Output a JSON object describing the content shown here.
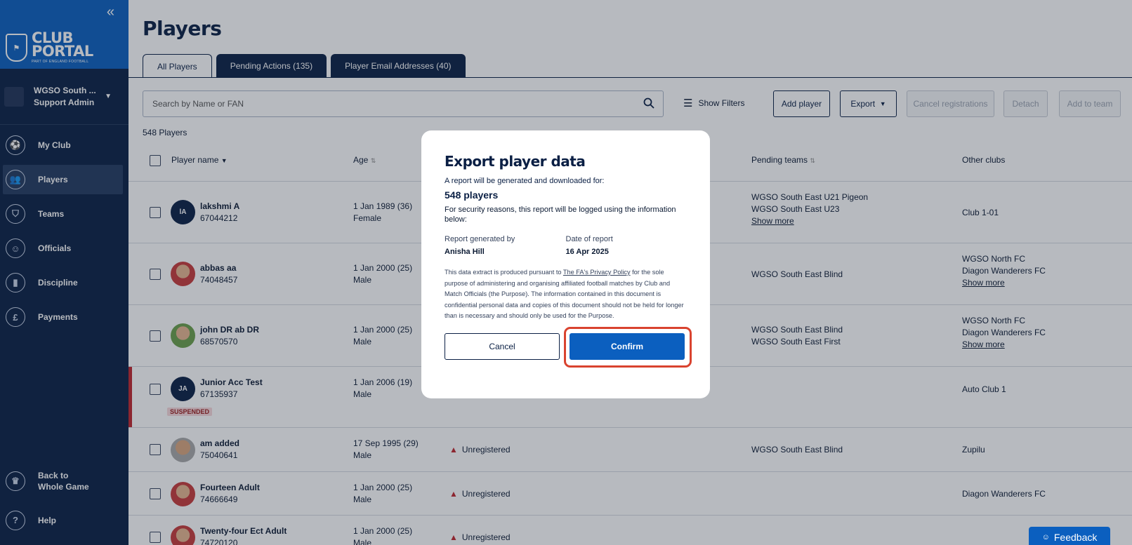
{
  "app": {
    "title": "CLUB PORTAL",
    "subtitle": "PART OF ENGLAND FOOTBALL"
  },
  "sidebar": {
    "club_name": "WGSO South ...",
    "role": "Support Admin",
    "items": [
      {
        "label": "My Club",
        "icon": "club-crest-icon"
      },
      {
        "label": "Players",
        "icon": "players-icon"
      },
      {
        "label": "Teams",
        "icon": "shield-icon"
      },
      {
        "label": "Officials",
        "icon": "officials-icon"
      },
      {
        "label": "Discipline",
        "icon": "cards-icon"
      },
      {
        "label": "Payments",
        "icon": "pound-icon"
      }
    ],
    "bottom": [
      {
        "label": "Back to Whole Game"
      },
      {
        "label": "Help"
      }
    ]
  },
  "page": {
    "title": "Players",
    "tabs": [
      "All Players",
      "Pending Actions (135)",
      "Player Email Addresses (40)"
    ],
    "search_placeholder": "Search by Name or FAN",
    "show_filters": "Show Filters",
    "buttons": {
      "add_player": "Add player",
      "export": "Export",
      "cancel_reg": "Cancel registrations",
      "detach": "Detach",
      "add_to_team": "Add to team"
    },
    "player_count": "548 Players",
    "columns": {
      "name": "Player name",
      "age": "Age",
      "pending_teams": "Pending teams",
      "other_clubs": "Other clubs"
    }
  },
  "rows": [
    {
      "initials": "lA",
      "name": "lakshmi A",
      "fan": "67044212",
      "age": "1 Jan 1989 (36)",
      "gender": "Female",
      "status": "",
      "pending1": "WGSO South East U21 Pigeon",
      "pending2": "WGSO South East U23",
      "pending_more": "Show more",
      "club1": "Club 1-01",
      "club2": "",
      "club_more": ""
    },
    {
      "initials": "",
      "name": "abbas aa",
      "fan": "74048457",
      "age": "1 Jan 2000 (25)",
      "gender": "Male",
      "status": "",
      "pending1": "WGSO South East Blind",
      "pending2": "",
      "pending_more": "",
      "club1": "WGSO North FC",
      "club2": "Diagon Wanderers FC",
      "club_more": "Show more"
    },
    {
      "initials": "",
      "name": "john DR ab DR",
      "fan": "68570570",
      "age": "1 Jan 2000 (25)",
      "gender": "Male",
      "status": "",
      "pending1": "WGSO South East Blind",
      "pending2": "WGSO South East First",
      "pending_more": "",
      "club1": "WGSO North FC",
      "club2": "Diagon Wanderers FC",
      "club_more": "Show more"
    },
    {
      "initials": "JA",
      "name": "Junior Acc Test",
      "fan": "67135937",
      "age": "1 Jan 2006 (19)",
      "gender": "Male",
      "status": "",
      "badge": "SUSPENDED",
      "pending1": "",
      "pending2": "",
      "pending_more": "",
      "club1": "Auto Club 1",
      "club2": "",
      "club_more": ""
    },
    {
      "initials": "",
      "name": "am added",
      "fan": "75040641",
      "age": "17 Sep 1995 (29)",
      "gender": "Male",
      "status": "Unregistered",
      "pending1": "WGSO South East Blind",
      "pending2": "",
      "pending_more": "",
      "club1": "Zupilu",
      "club2": "",
      "club_more": ""
    },
    {
      "initials": "",
      "name": "Fourteen Adult",
      "fan": "74666649",
      "age": "1 Jan 2000 (25)",
      "gender": "Male",
      "status": "Unregistered",
      "pending1": "",
      "pending2": "",
      "pending_more": "",
      "club1": "Diagon Wanderers FC",
      "club2": "",
      "club_more": ""
    },
    {
      "initials": "",
      "name": "Twenty-four Ect Adult",
      "fan": "74720120",
      "age": "1 Jan 2000 (25)",
      "gender": "Male",
      "status": "Unregistered",
      "pending1": "",
      "pending2": "",
      "pending_more": "",
      "club1": "",
      "club2": "",
      "club_more": ""
    }
  ],
  "modal": {
    "title": "Export player data",
    "intro": "A report will be generated and downloaded for:",
    "count": "548 players",
    "security": "For security reasons, this report will be logged using the information below:",
    "generated_by_label": "Report generated by",
    "generated_by": "Anisha Hill",
    "date_label": "Date of report",
    "date": "16 Apr 2025",
    "legal_pre": "This data extract is produced pursuant to ",
    "legal_link": "The FA's Privacy Policy",
    "legal_post": " for the sole purpose of administering and organising affiliated football matches by Club and Match Officials (the Purpose). The information contained in this document is confidential personal data and copies of this document should not be held for longer than is necessary and should only be used for the Purpose.",
    "cancel": "Cancel",
    "confirm": "Confirm"
  },
  "feedback": "Feedback"
}
